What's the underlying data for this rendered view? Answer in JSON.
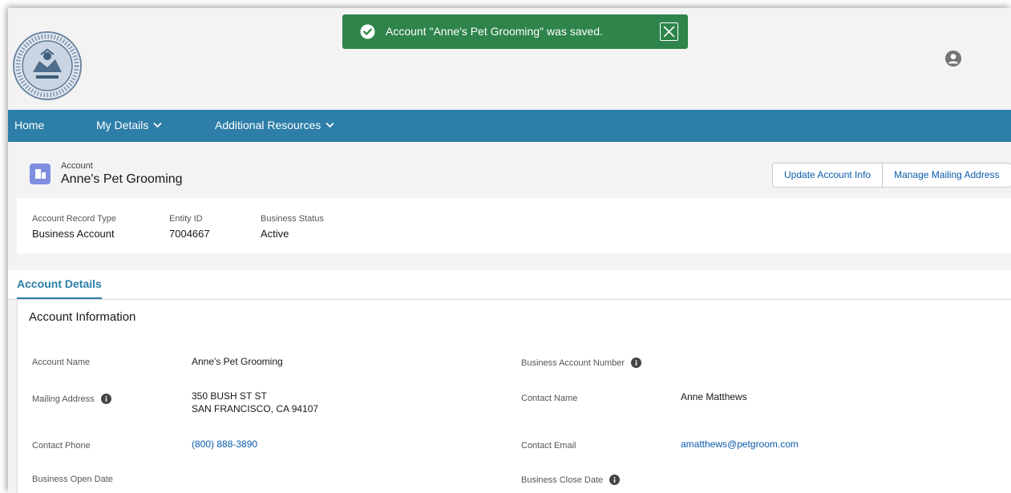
{
  "toast": {
    "message": "Account \"Anne's Pet Grooming\" was saved.",
    "color": "#2e844a"
  },
  "nav": {
    "items": [
      {
        "label": "Home"
      },
      {
        "label": "My Details"
      },
      {
        "label": "Additional Resources"
      }
    ],
    "color": "#2d7ea8"
  },
  "record": {
    "object_label": "Account",
    "name": "Anne's Pet Grooming",
    "actions": [
      "Update Account Info",
      "Manage Mailing Address"
    ]
  },
  "highlights": [
    {
      "label": "Account Record Type",
      "value": "Business Account"
    },
    {
      "label": "Entity ID",
      "value": "7004667"
    },
    {
      "label": "Business Status",
      "value": "Active"
    }
  ],
  "tabs": {
    "active": "Account Details"
  },
  "details": {
    "section_title": "Account Information",
    "account_name": {
      "label": "Account Name",
      "value": "Anne's Pet Grooming"
    },
    "business_account_number": {
      "label": "Business Account Number",
      "value": ""
    },
    "mailing_address": {
      "label": "Mailing Address",
      "line1": "350 BUSH ST ST",
      "line2": "SAN FRANCISCO, CA 94107"
    },
    "contact_name": {
      "label": "Contact Name",
      "value": "Anne Matthews"
    },
    "contact_phone": {
      "label": "Contact Phone",
      "value": "(800) 888-3890"
    },
    "contact_email": {
      "label": "Contact Email",
      "value": "amatthews@petgroom.com"
    },
    "business_open_date": {
      "label": "Business Open Date",
      "value": ""
    },
    "business_close_date": {
      "label": "Business Close Date",
      "value": ""
    }
  },
  "icons": {
    "seal": "city-seal-logo",
    "avatar": "user-avatar-icon",
    "toast_check": "check-circle-icon",
    "toast_close": "close-icon",
    "info": "info-icon",
    "object": "account-icon"
  }
}
